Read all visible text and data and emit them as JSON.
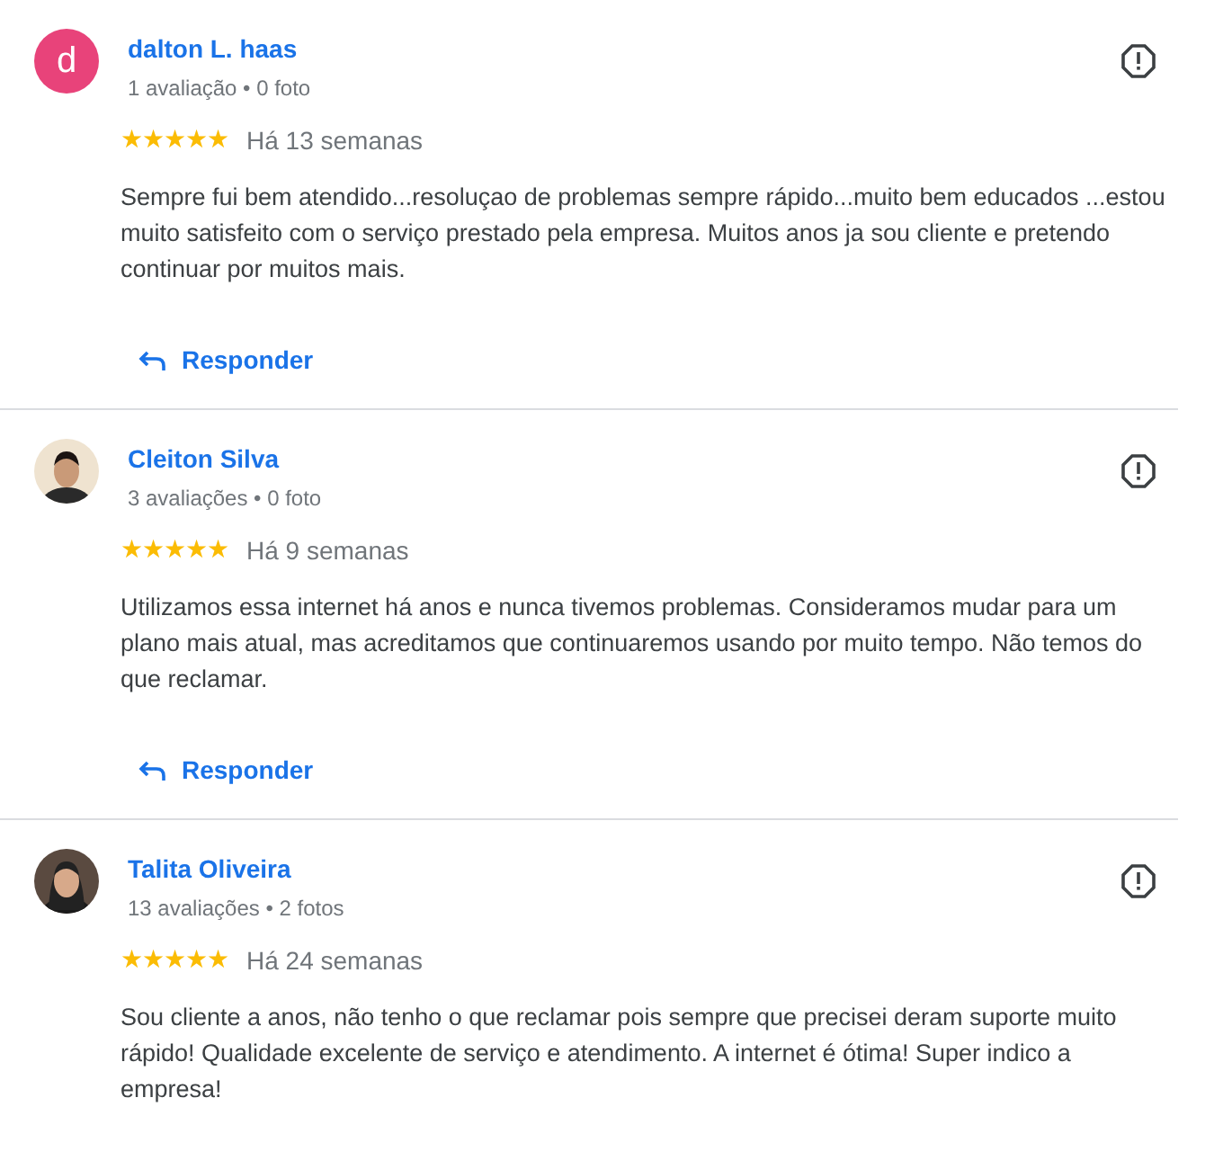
{
  "reviews": [
    {
      "avatar": {
        "kind": "letter",
        "letter": "d"
      },
      "name": "dalton L. haas",
      "meta": "1 avaliação • 0 foto",
      "stars": 5,
      "time": "Há 13 semanas",
      "text": "Sempre fui bem atendido...resoluçao de problemas sempre rápido...muito bem educados ...estou muito satisfeito com o serviço prestado pela empresa. Muitos anos ja sou cliente e pretendo continuar por muitos mais.",
      "reply": "Responder"
    },
    {
      "name": "Cleiton Silva",
      "meta": "3 avaliações • 0 foto",
      "stars": 5,
      "time": "Há 9 semanas",
      "text": "Utilizamos essa internet há anos e nunca tivemos problemas. Consideramos mudar para um plano mais atual, mas acreditamos que continuaremos usando por muito tempo. Não temos do que reclamar.",
      "reply": "Responder"
    },
    {
      "name": "Talita Oliveira",
      "meta": "13 avaliações • 2 fotos",
      "stars": 5,
      "time": "Há 24 semanas",
      "text": "Sou cliente a anos, não tenho o que reclamar pois sempre que precisei deram suporte muito rápido! Qualidade excelente de serviço e atendimento. A internet é ótima! Super indico a empresa!"
    }
  ]
}
